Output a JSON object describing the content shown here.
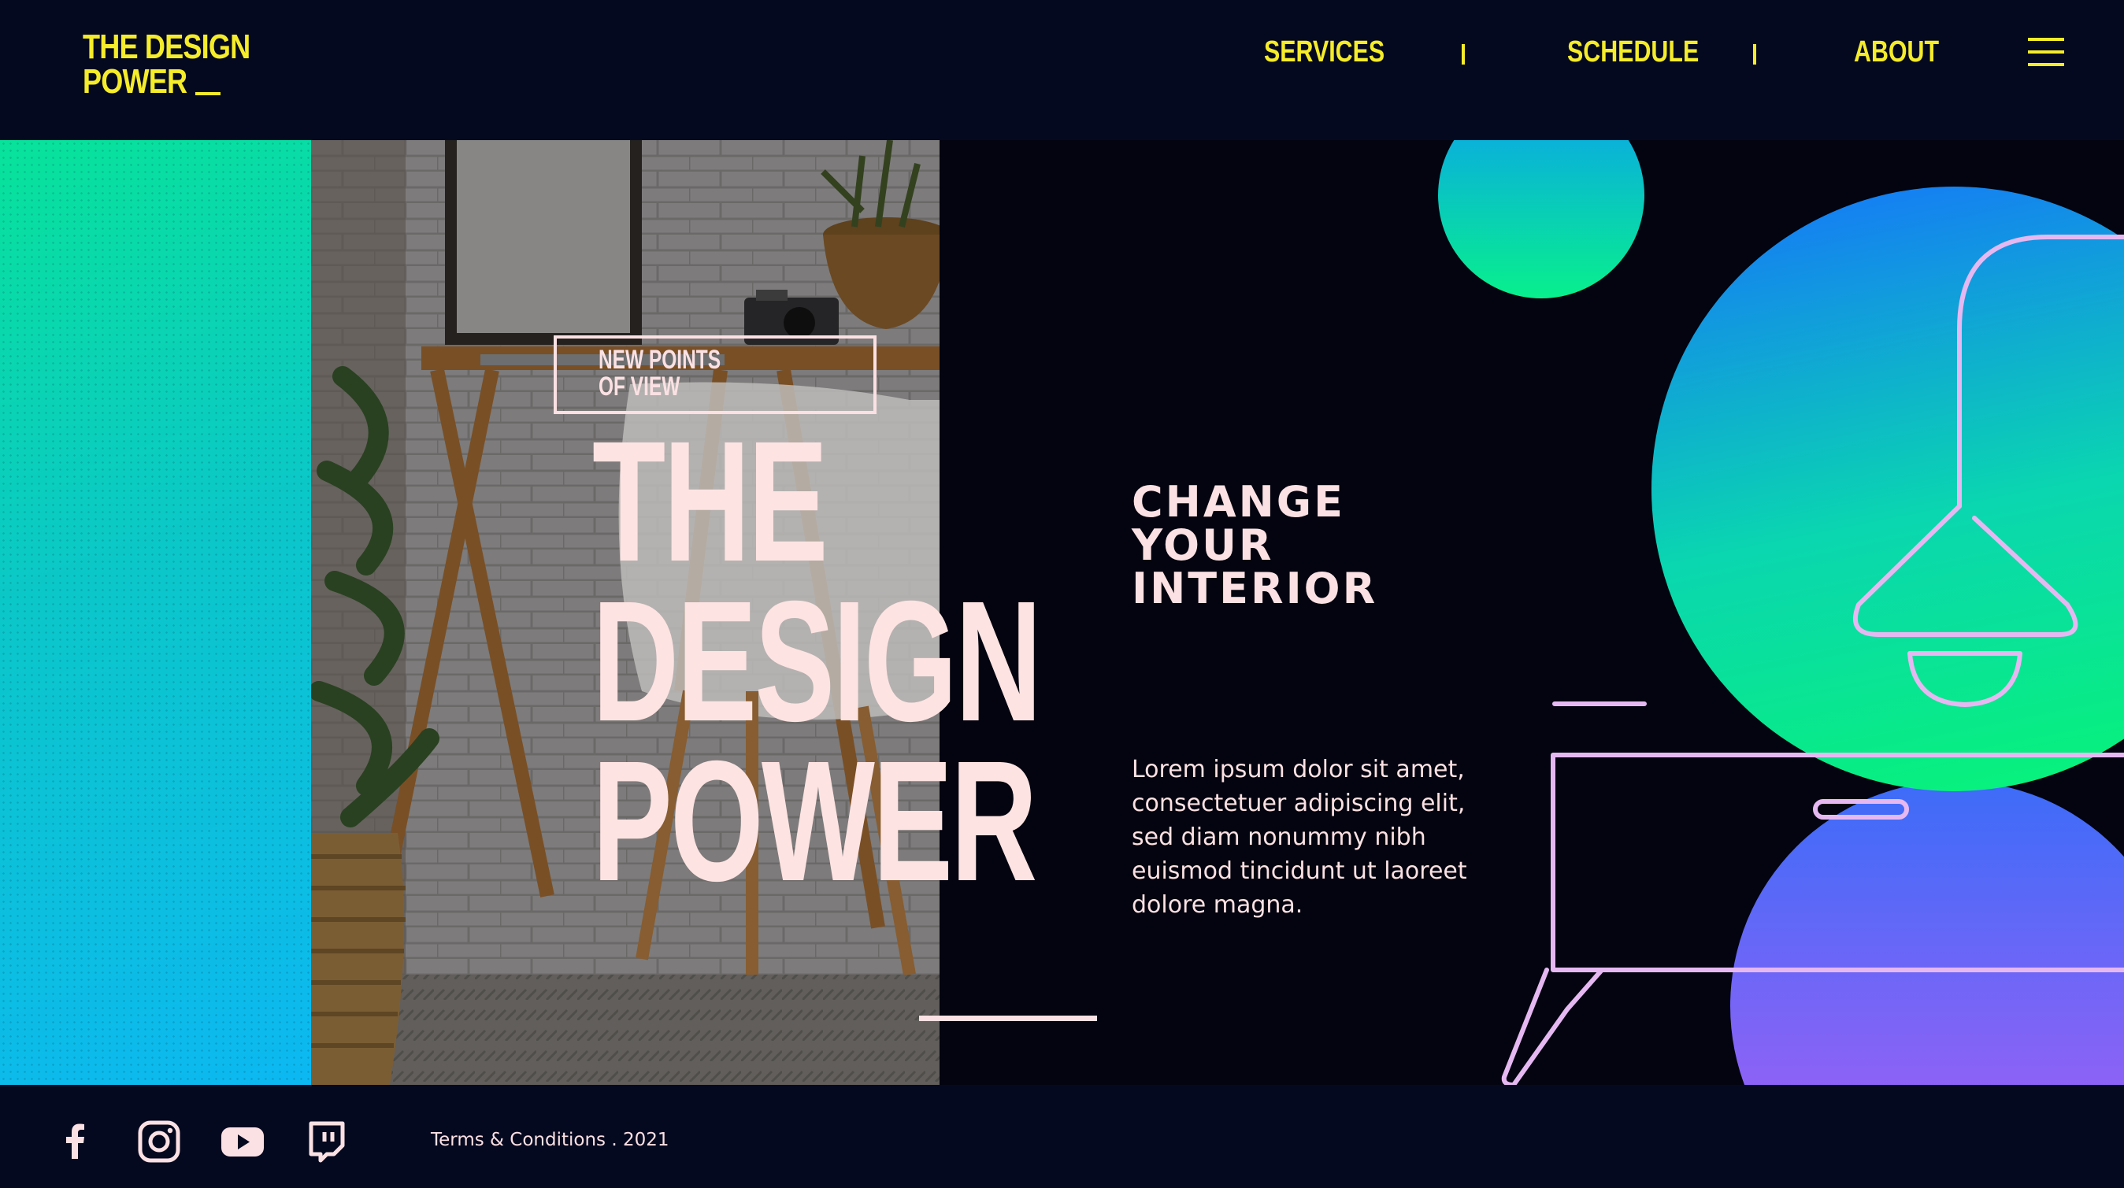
{
  "header": {
    "logo_line1": "THE DESIGN",
    "logo_line2": "POWER",
    "nav": [
      {
        "label": "SERVICES"
      },
      {
        "label": "SCHEDULE"
      },
      {
        "label": "ABOUT"
      }
    ],
    "menu_icon": "hamburger-icon"
  },
  "hero": {
    "tag": "NEW POINTS\nOF VIEW",
    "title_lines": [
      "THE",
      "DESIGN",
      "POWER"
    ],
    "subheading": "CHANGE\nYOUR\nINTERIOR",
    "body": "Lorem ipsum dolor sit amet, consectetuer adipiscing elit, sed diam nonummy nibh euismod tincidunt ut laoreet dolore magna."
  },
  "footer": {
    "social": [
      {
        "icon": "facebook-icon"
      },
      {
        "icon": "instagram-icon"
      },
      {
        "icon": "youtube-icon"
      },
      {
        "icon": "twitch-icon"
      }
    ],
    "terms": "Terms & Conditions . 2021"
  },
  "colors": {
    "background": "#050920",
    "accent_yellow": "#f5ec2a",
    "text_pink": "#fbe1e3",
    "gradient_green": "#08e39a",
    "gradient_blue": "#1289f5",
    "gradient_purple": "#a35cf5",
    "line_lilac": "#e6b8f2"
  }
}
